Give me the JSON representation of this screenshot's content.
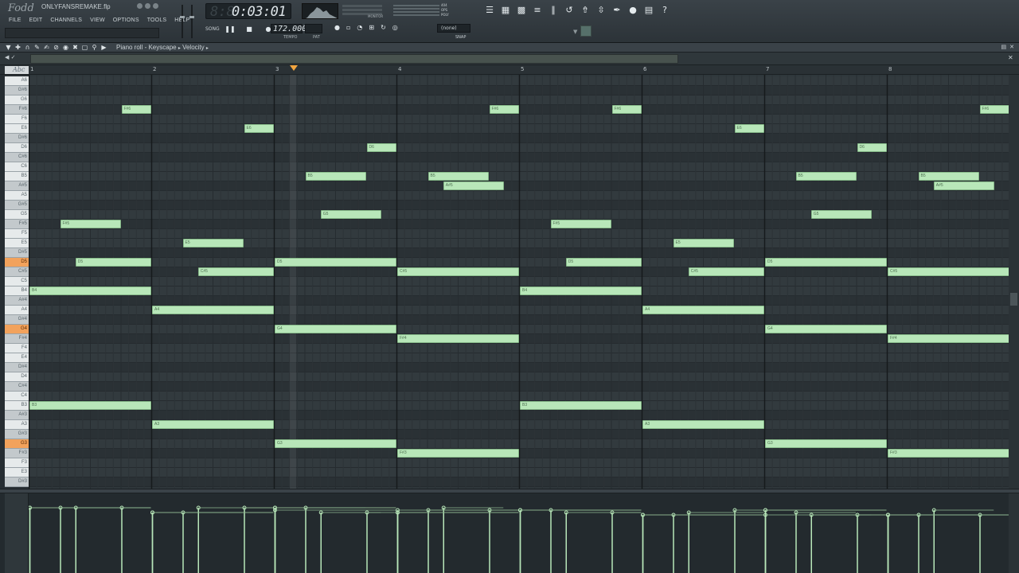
{
  "app": {
    "logo": "Fodd",
    "filename": "ONLYFANSREMAKE.flp"
  },
  "menu": [
    "FILE",
    "EDIT",
    "CHANNELS",
    "VIEW",
    "OPTIONS",
    "TOOLS",
    "HELP"
  ],
  "transport": {
    "time": "0:03:01",
    "time_ghost": "8:8",
    "pat_song": "SONG",
    "tempo": "172.000",
    "tempo_label": "TEMPO",
    "pat_label": "PAT",
    "monitor_label": "MONITOR",
    "snap_value": "(none)",
    "snap_label": "SNAP",
    "cpu_labels": [
      "404",
      "OPS",
      "POLY"
    ]
  },
  "toolbar_icons": [
    "playlist-icon",
    "piano-roll-icon",
    "channel-rack-icon",
    "mixer-icon",
    "browser-icon",
    "undo-icon",
    "export-icon",
    "render-icon",
    "brush-icon",
    "mic-icon",
    "file-icon",
    "help-icon"
  ],
  "piano_roll": {
    "title": "Piano roll - Keyscape",
    "sep": "▸",
    "target": "Velocity",
    "abc": "Abc",
    "bars": [
      "1",
      "2",
      "3",
      "4",
      "5",
      "6",
      "7",
      "8"
    ]
  },
  "keys": [
    {
      "label": "A6",
      "black": false,
      "hl": false
    },
    {
      "label": "G#6",
      "black": true,
      "hl": false
    },
    {
      "label": "G6",
      "black": false,
      "hl": false
    },
    {
      "label": "F#6",
      "black": true,
      "hl": false
    },
    {
      "label": "F6",
      "black": false,
      "hl": false
    },
    {
      "label": "E6",
      "black": false,
      "hl": false
    },
    {
      "label": "D#6",
      "black": true,
      "hl": false
    },
    {
      "label": "D6",
      "black": false,
      "hl": false
    },
    {
      "label": "C#6",
      "black": true,
      "hl": false
    },
    {
      "label": "C6",
      "black": false,
      "hl": false
    },
    {
      "label": "B5",
      "black": false,
      "hl": false
    },
    {
      "label": "A#5",
      "black": true,
      "hl": false
    },
    {
      "label": "A5",
      "black": false,
      "hl": false
    },
    {
      "label": "G#5",
      "black": true,
      "hl": false
    },
    {
      "label": "G5",
      "black": false,
      "hl": false
    },
    {
      "label": "F#5",
      "black": true,
      "hl": false
    },
    {
      "label": "F5",
      "black": false,
      "hl": false
    },
    {
      "label": "E5",
      "black": false,
      "hl": false
    },
    {
      "label": "D#5",
      "black": true,
      "hl": false
    },
    {
      "label": "D5",
      "black": false,
      "hl": true
    },
    {
      "label": "C#5",
      "black": true,
      "hl": false
    },
    {
      "label": "C5",
      "black": false,
      "hl": false
    },
    {
      "label": "B4",
      "black": false,
      "hl": false
    },
    {
      "label": "A#4",
      "black": true,
      "hl": false
    },
    {
      "label": "A4",
      "black": false,
      "hl": false
    },
    {
      "label": "G#4",
      "black": true,
      "hl": false
    },
    {
      "label": "G4",
      "black": false,
      "hl": true
    },
    {
      "label": "F#4",
      "black": true,
      "hl": false
    },
    {
      "label": "F4",
      "black": false,
      "hl": false
    },
    {
      "label": "E4",
      "black": false,
      "hl": false
    },
    {
      "label": "D#4",
      "black": true,
      "hl": false
    },
    {
      "label": "D4",
      "black": false,
      "hl": false
    },
    {
      "label": "C#4",
      "black": true,
      "hl": false
    },
    {
      "label": "C4",
      "black": false,
      "hl": false
    },
    {
      "label": "B3",
      "black": false,
      "hl": false
    },
    {
      "label": "A#3",
      "black": true,
      "hl": false
    },
    {
      "label": "A3",
      "black": false,
      "hl": false
    },
    {
      "label": "G#3",
      "black": true,
      "hl": false
    },
    {
      "label": "G3",
      "black": false,
      "hl": true
    },
    {
      "label": "F#3",
      "black": true,
      "hl": false
    },
    {
      "label": "F3",
      "black": false,
      "hl": false
    },
    {
      "label": "E3",
      "black": false,
      "hl": false
    },
    {
      "label": "D#3",
      "black": true,
      "hl": false
    }
  ],
  "notes": [
    {
      "pitch": "F#6",
      "start": 0.75,
      "len": 0.25
    },
    {
      "pitch": "F#6",
      "start": 3.75,
      "len": 0.25
    },
    {
      "pitch": "F#6",
      "start": 4.75,
      "len": 0.25
    },
    {
      "pitch": "F#6",
      "start": 7.75,
      "len": 0.25
    },
    {
      "pitch": "E6",
      "start": 1.75,
      "len": 0.25
    },
    {
      "pitch": "E6",
      "start": 5.75,
      "len": 0.25
    },
    {
      "pitch": "D6",
      "start": 2.75,
      "len": 0.25
    },
    {
      "pitch": "D6",
      "start": 6.75,
      "len": 0.25
    },
    {
      "pitch": "B5",
      "start": 2.25,
      "len": 0.5
    },
    {
      "pitch": "B5",
      "start": 3.25,
      "len": 0.5
    },
    {
      "pitch": "B5",
      "start": 6.25,
      "len": 0.5
    },
    {
      "pitch": "B5",
      "start": 7.25,
      "len": 0.5
    },
    {
      "pitch": "A#5",
      "start": 3.375,
      "len": 0.5
    },
    {
      "pitch": "A#5",
      "start": 7.375,
      "len": 0.5
    },
    {
      "pitch": "G5",
      "start": 2.375,
      "len": 0.5
    },
    {
      "pitch": "G5",
      "start": 6.375,
      "len": 0.5
    },
    {
      "pitch": "F#5",
      "start": 0.25,
      "len": 0.5
    },
    {
      "pitch": "F#5",
      "start": 4.25,
      "len": 0.5
    },
    {
      "pitch": "E5",
      "start": 1.25,
      "len": 0.5
    },
    {
      "pitch": "E5",
      "start": 5.25,
      "len": 0.5
    },
    {
      "pitch": "D5",
      "start": 0.375,
      "len": 0.625
    },
    {
      "pitch": "D5",
      "start": 2.0,
      "len": 1.0
    },
    {
      "pitch": "D5",
      "start": 4.375,
      "len": 0.625
    },
    {
      "pitch": "D5",
      "start": 6.0,
      "len": 1.0
    },
    {
      "pitch": "C#5",
      "start": 1.375,
      "len": 0.625
    },
    {
      "pitch": "C#5",
      "start": 3.0,
      "len": 1.0
    },
    {
      "pitch": "C#5",
      "start": 5.375,
      "len": 0.625
    },
    {
      "pitch": "C#5",
      "start": 7.0,
      "len": 1.0
    },
    {
      "pitch": "B4",
      "start": 0.0,
      "len": 1.0
    },
    {
      "pitch": "B4",
      "start": 4.0,
      "len": 1.0
    },
    {
      "pitch": "A4",
      "start": 1.0,
      "len": 1.0
    },
    {
      "pitch": "A4",
      "start": 5.0,
      "len": 1.0
    },
    {
      "pitch": "G4",
      "start": 2.0,
      "len": 1.0
    },
    {
      "pitch": "G4",
      "start": 6.0,
      "len": 1.0
    },
    {
      "pitch": "F#4",
      "start": 3.0,
      "len": 1.0
    },
    {
      "pitch": "F#4",
      "start": 7.0,
      "len": 1.0
    },
    {
      "pitch": "B3",
      "start": 0.0,
      "len": 1.0
    },
    {
      "pitch": "B3",
      "start": 4.0,
      "len": 1.0
    },
    {
      "pitch": "A3",
      "start": 1.0,
      "len": 1.0
    },
    {
      "pitch": "A3",
      "start": 5.0,
      "len": 1.0
    },
    {
      "pitch": "G3",
      "start": 2.0,
      "len": 1.0
    },
    {
      "pitch": "G3",
      "start": 6.0,
      "len": 1.0
    },
    {
      "pitch": "F#3",
      "start": 3.0,
      "len": 1.0
    },
    {
      "pitch": "F#3",
      "start": 7.0,
      "len": 1.0
    }
  ],
  "colors": {
    "note_fill": "#b8e7b9",
    "key_highlight": "#f2a25c",
    "playhead": "#f2a640"
  }
}
